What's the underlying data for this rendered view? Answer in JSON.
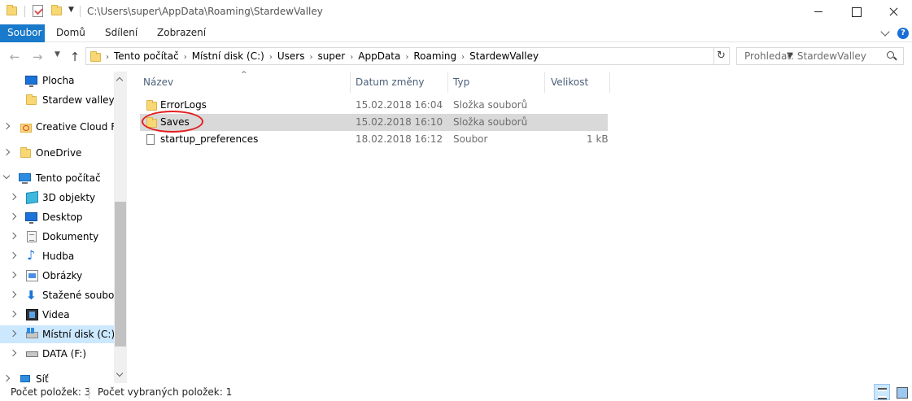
{
  "titlebar": {
    "path": "C:\\Users\\super\\AppData\\Roaming\\StardewValley"
  },
  "ribbon": {
    "tabs": [
      "Soubor",
      "Domů",
      "Sdílení",
      "Zobrazení"
    ],
    "help_label": "?"
  },
  "address": {
    "crumbs": [
      "Tento počítač",
      "Místní disk (C:)",
      "Users",
      "super",
      "AppData",
      "Roaming",
      "StardewValley"
    ],
    "search_placeholder": "Prohledat: StardewValley"
  },
  "navpane": {
    "items": [
      {
        "label": "Plocha",
        "icon": "desktop-icon"
      },
      {
        "label": "Stardew valley m",
        "icon": "folder-icon"
      },
      {
        "label": "Creative Cloud Fil",
        "icon": "creative-cloud-icon"
      },
      {
        "label": "OneDrive",
        "icon": "folder-icon"
      },
      {
        "label": "Tento počítač",
        "icon": "computer-icon"
      },
      {
        "label": "3D objekty",
        "icon": "3d-objects-icon"
      },
      {
        "label": "Desktop",
        "icon": "desktop-icon"
      },
      {
        "label": "Dokumenty",
        "icon": "documents-icon"
      },
      {
        "label": "Hudba",
        "icon": "music-icon"
      },
      {
        "label": "Obrázky",
        "icon": "pictures-icon"
      },
      {
        "label": "Stažené soubory",
        "icon": "downloads-icon"
      },
      {
        "label": "Videa",
        "icon": "videos-icon"
      },
      {
        "label": "Místní disk (C:)",
        "icon": "local-disk-icon"
      },
      {
        "label": "DATA (F:)",
        "icon": "drive-icon"
      },
      {
        "label": "Síť",
        "icon": "network-icon"
      }
    ]
  },
  "filelist": {
    "columns": [
      "Název",
      "Datum změny",
      "Typ",
      "Velikost"
    ],
    "rows": [
      {
        "name": "ErrorLogs",
        "date": "15.02.2018 16:04",
        "type": "Složka souborů",
        "size": ""
      },
      {
        "name": "Saves",
        "date": "15.02.2018 16:10",
        "type": "Složka souborů",
        "size": ""
      },
      {
        "name": "startup_preferences",
        "date": "18.02.2018 16:12",
        "type": "Soubor",
        "size": "1 kB"
      }
    ]
  },
  "statusbar": {
    "item_count": "Počet položek: 3",
    "selected_count": "Počet vybraných položek: 1"
  },
  "colors": {
    "accent": "#1979ca",
    "selection": "#cce8ff",
    "annotation": "#e41e1e"
  }
}
